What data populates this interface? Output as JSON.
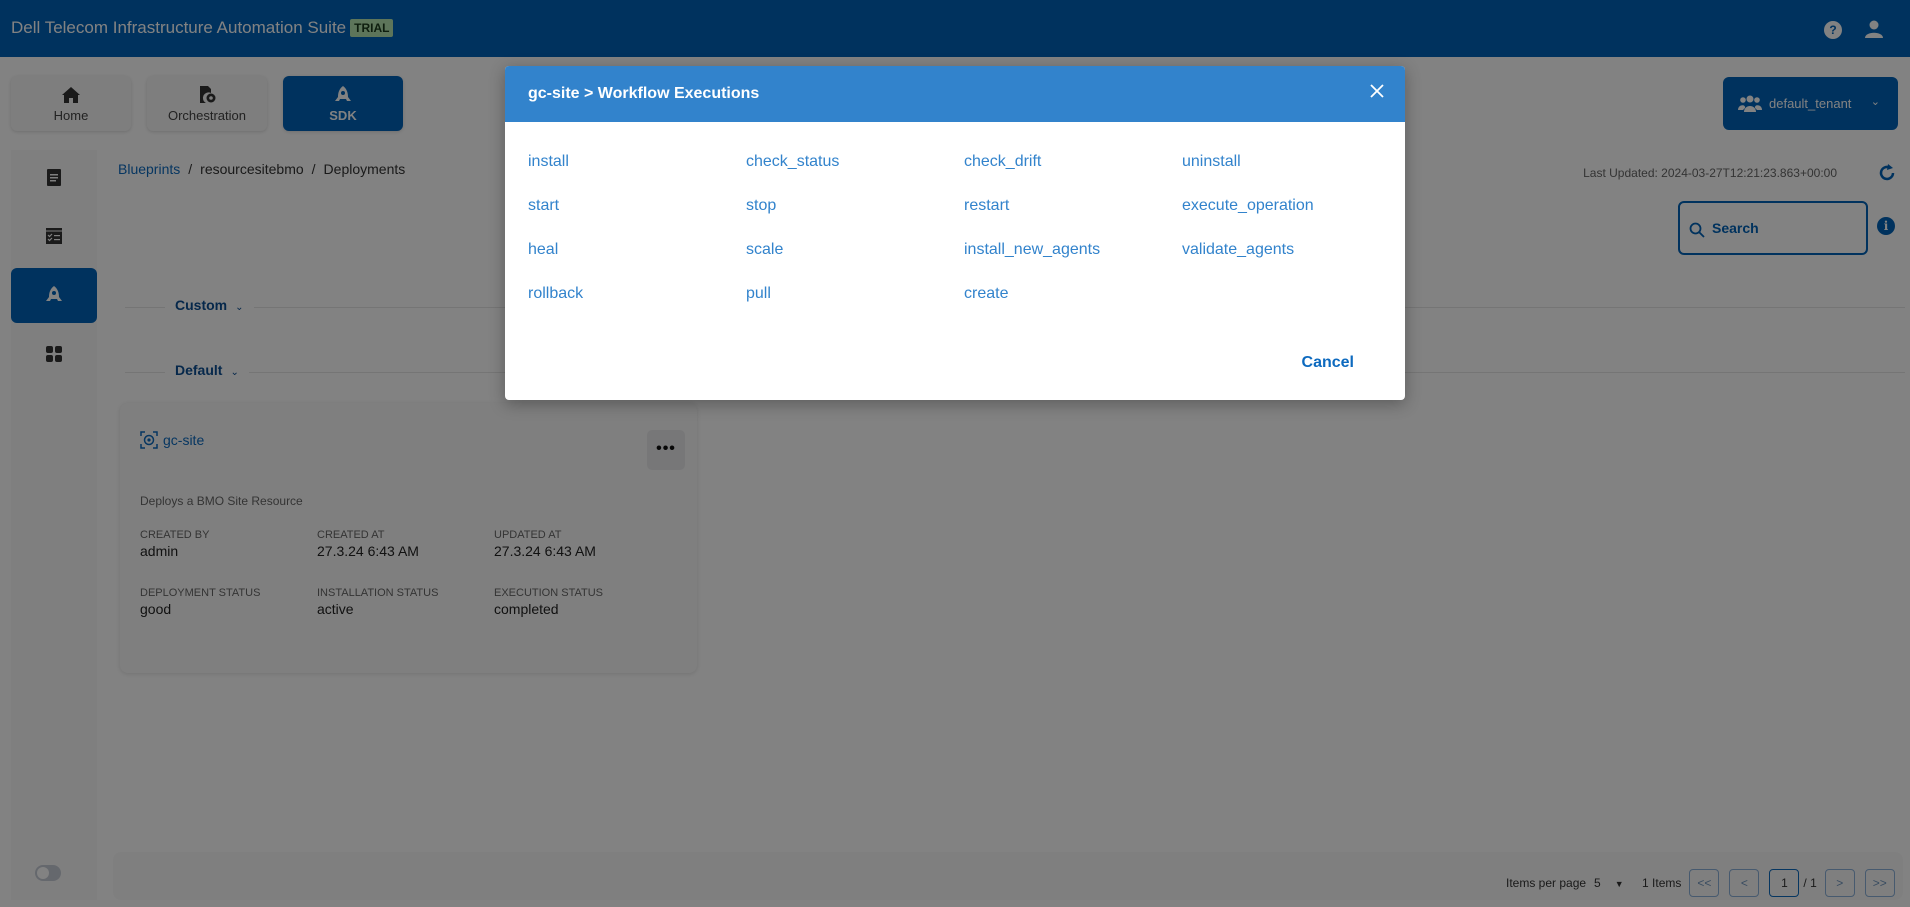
{
  "app": {
    "title": "Dell Telecom Infrastructure Automation Suite",
    "badge": "TRIAL",
    "help_label": "?"
  },
  "nav": {
    "items": [
      {
        "label": "Home",
        "icon": "home-icon",
        "active": false
      },
      {
        "label": "Orchestration",
        "icon": "orchestration-icon",
        "active": false
      },
      {
        "label": "SDK",
        "icon": "rocket-icon",
        "active": true
      }
    ]
  },
  "tenant": {
    "label": "default_tenant",
    "icon": "users-icon"
  },
  "sidebar": {
    "items": [
      {
        "icon": "notepad-icon",
        "active": false
      },
      {
        "icon": "checklist-icon",
        "active": false
      },
      {
        "icon": "rocket-icon",
        "active": true
      },
      {
        "icon": "grid-icon",
        "active": false
      }
    ]
  },
  "breadcrumb": {
    "items": [
      "Blueprints",
      "resourcesitebmo",
      "Deployments"
    ],
    "separator": "/"
  },
  "toolbar": {
    "last_updated": "Last Updated: 2024-03-27T12:21:23.863+00:00",
    "search_placeholder": "Search",
    "info_label": "i"
  },
  "groups": [
    {
      "label": "Custom"
    },
    {
      "label": "Default"
    }
  ],
  "deployment_card": {
    "name": "gc-site",
    "menu_label": "•••",
    "description": "Deploys a BMO Site Resource",
    "fields": [
      {
        "key": "CREATED BY",
        "value": "admin"
      },
      {
        "key": "CREATED AT",
        "value": "27.3.24 6:43 AM"
      },
      {
        "key": "UPDATED AT",
        "value": "27.3.24 6:43 AM"
      },
      {
        "key": "DEPLOYMENT STATUS",
        "value": "good"
      },
      {
        "key": "INSTALLATION STATUS",
        "value": "active"
      },
      {
        "key": "EXECUTION STATUS",
        "value": "completed"
      }
    ]
  },
  "pagination": {
    "items_per_page_label": "Items per page",
    "items_per_page": "5",
    "item_count": "1 Items",
    "first": "<<",
    "prev": "<",
    "current_page": "1",
    "total_pages": "/ 1",
    "next": ">",
    "last": ">>"
  },
  "modal": {
    "title": "gc-site > Workflow Executions",
    "workflows": [
      "install",
      "check_status",
      "check_drift",
      "uninstall",
      "start",
      "stop",
      "restart",
      "execute_operation",
      "heal",
      "scale",
      "install_new_agents",
      "validate_agents",
      "rollback",
      "pull",
      "create"
    ],
    "cancel_label": "Cancel"
  },
  "colors": {
    "brand": "#0063b8",
    "modal_header": "#3283cc",
    "link": "#0d6abf"
  }
}
